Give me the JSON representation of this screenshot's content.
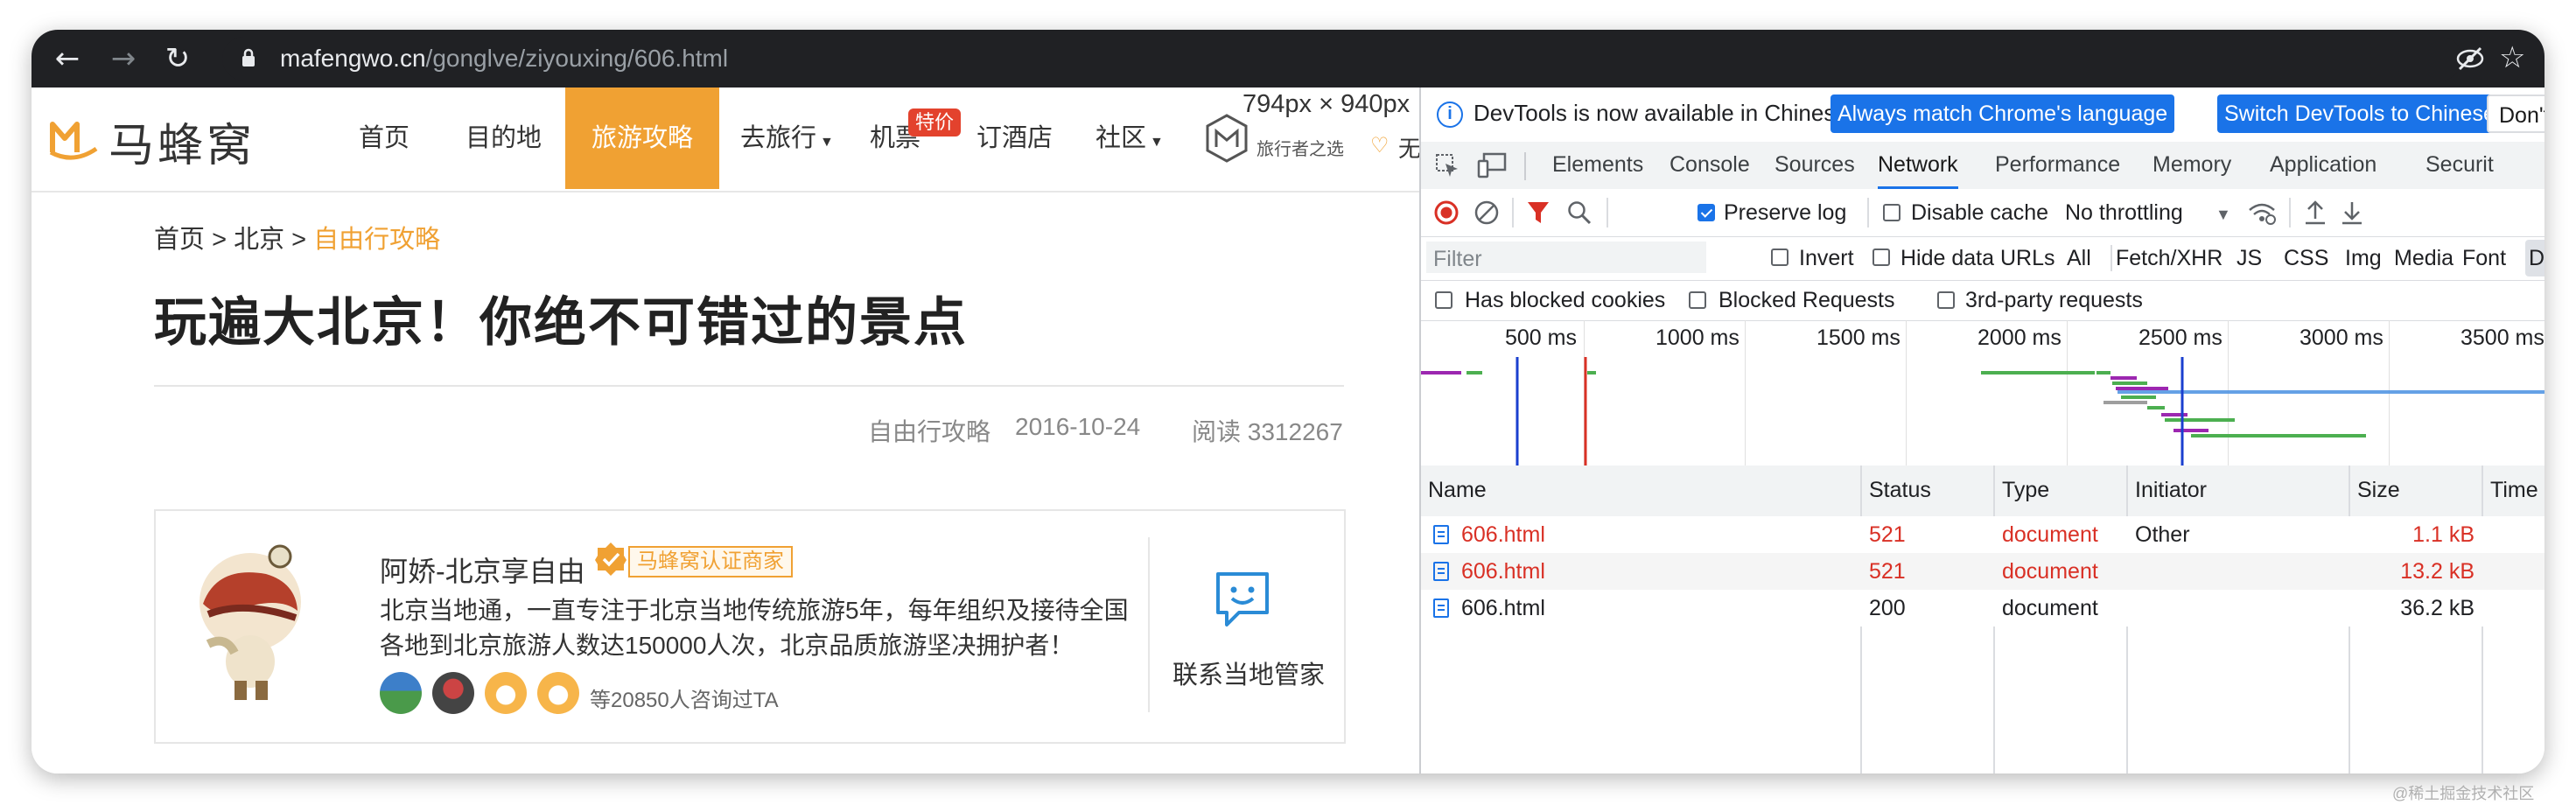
{
  "browser": {
    "url_host": "mafengwo.cn",
    "url_path": "/gonglve/ziyouxing/606.html",
    "icons": [
      "back-icon",
      "forward-icon",
      "reload-icon",
      "lock-icon",
      "eye-off-icon",
      "bookmark-star-icon"
    ]
  },
  "site": {
    "logo_text": "马蜂窝",
    "nav": [
      "首页",
      "目的地",
      "旅游攻略",
      "去旅行",
      "机票",
      "订酒店",
      "社区"
    ],
    "hot_badge": "特价",
    "dims_overlay": "794px × 940px",
    "stamp_text": "旅行者之选",
    "wu_text": "无",
    "accent_color": "#f0a133"
  },
  "article": {
    "breadcrumb": [
      "首页",
      ">",
      "北京",
      ">",
      "自由行攻略"
    ],
    "title": "玩遍大北京！你绝不可错过的景点",
    "category": "自由行攻略",
    "date": "2016-10-24",
    "reads": "阅读 3312267"
  },
  "author_card": {
    "name": "阿娇-北京享自由",
    "badge": "马蜂窝认证商家",
    "description": "北京当地通，一直专注于北京当地传统旅游5年，每年组织及接待全国各地到北京旅游人数达150000人次，北京品质旅游坚决拥护者！",
    "consulted": "等20850人咨询过TA",
    "contact_label": "联系当地管家"
  },
  "devtools": {
    "info_text": "DevTools is now available in Chinese!",
    "btn_match": "Always match Chrome's language",
    "btn_switch": "Switch DevTools to Chinese",
    "btn_dont": "Don't",
    "tabs": [
      "Elements",
      "Console",
      "Sources",
      "Network",
      "Performance",
      "Memory",
      "Application",
      "Securit"
    ],
    "active_tab": "Network",
    "toolbar": {
      "preserve_log": "Preserve log",
      "disable_cache": "Disable cache",
      "throttling": "No throttling"
    },
    "filter": {
      "placeholder": "Filter",
      "invert": "Invert",
      "hide_data_urls": "Hide data URLs",
      "types": [
        "All",
        "Fetch/XHR",
        "JS",
        "CSS",
        "Img",
        "Media",
        "Font",
        "Doc"
      ],
      "selected_type": "Doc"
    },
    "options": {
      "blocked_cookies": "Has blocked cookies",
      "blocked_requests": "Blocked Requests",
      "third_party": "3rd-party requests"
    },
    "timeline_labels": [
      "500 ms",
      "1000 ms",
      "1500 ms",
      "2000 ms",
      "2500 ms",
      "3000 ms",
      "3500 ms"
    ],
    "columns": [
      "Name",
      "Status",
      "Type",
      "Initiator",
      "Size",
      "Time"
    ],
    "rows": [
      {
        "name": "606.html",
        "status": "521",
        "type": "document",
        "initiator": "Other",
        "size": "1.1 kB"
      },
      {
        "name": "606.html",
        "status": "521",
        "type": "document",
        "initiator": "",
        "size": "13.2 kB"
      },
      {
        "name": "606.html",
        "status": "200",
        "type": "document",
        "initiator": "",
        "size": "36.2 kB"
      }
    ],
    "error_color": "#d93025"
  },
  "watermark": "@稀土掘金技术社区"
}
